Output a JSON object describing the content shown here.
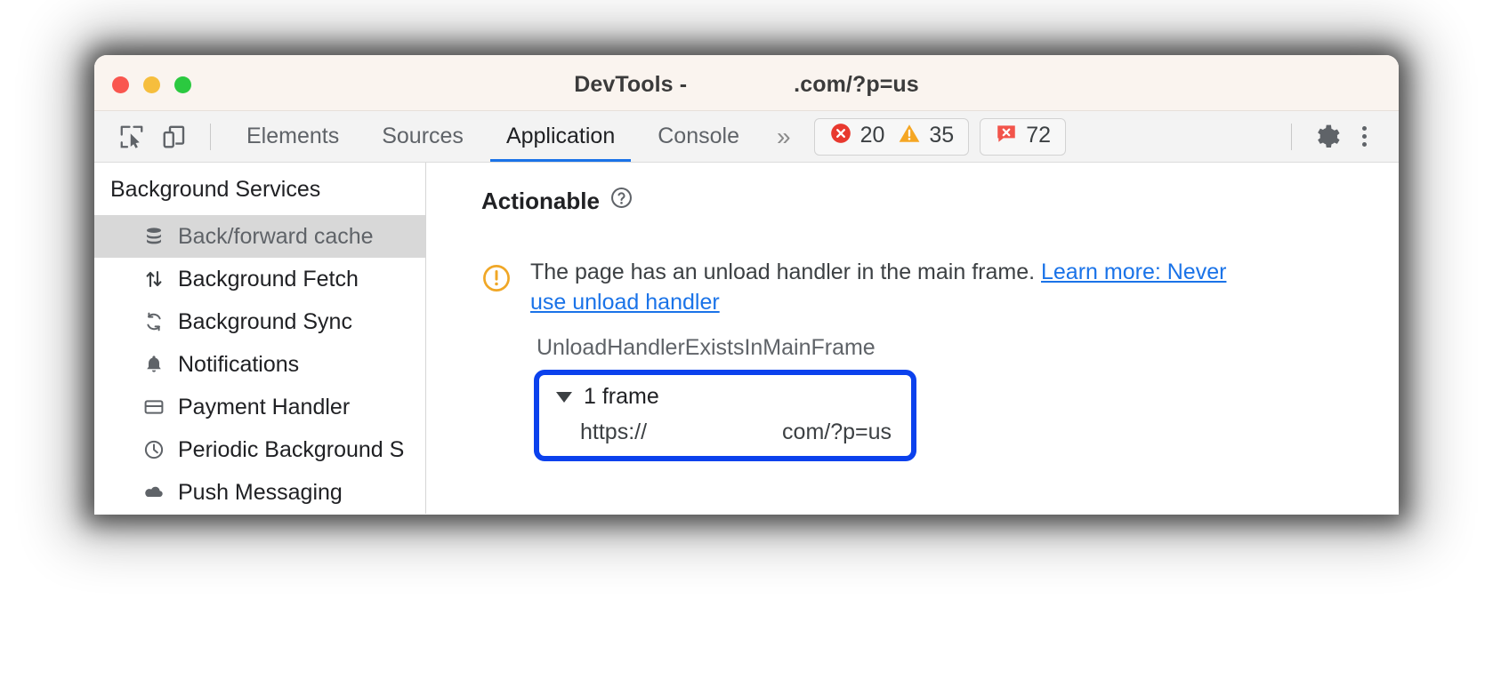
{
  "window": {
    "title_prefix": "DevTools -",
    "title_suffix": ".com/?p=us",
    "traffic_lights": [
      "close",
      "minimize",
      "maximize"
    ]
  },
  "toolbar": {
    "inspect_icon": "inspect-element-icon",
    "device_icon": "device-toolbar-icon",
    "overflow_label": "»",
    "tabs": [
      {
        "label": "Elements",
        "active": false
      },
      {
        "label": "Sources",
        "active": false
      },
      {
        "label": "Application",
        "active": true
      },
      {
        "label": "Console",
        "active": false
      }
    ],
    "counters": [
      {
        "name": "errors",
        "icon": "error-circle-icon",
        "value": "20",
        "color": "#e8392f"
      },
      {
        "name": "warnings",
        "icon": "warning-triangle-icon",
        "value": "35",
        "color": "#f5a623"
      },
      {
        "name": "issues",
        "icon": "issue-bubble-icon",
        "value": "72",
        "color": "#f2544b"
      }
    ],
    "settings_icon": "gear-icon",
    "more_icon": "kebab-menu-icon",
    "active_tab_color": "#1a73e8"
  },
  "sidebar": {
    "section_title": "Background Services",
    "items": [
      {
        "label": "Back/forward cache",
        "icon": "database-icon",
        "selected": true
      },
      {
        "label": "Background Fetch",
        "icon": "up-down-arrows-icon",
        "selected": false
      },
      {
        "label": "Background Sync",
        "icon": "sync-arrows-icon",
        "selected": false
      },
      {
        "label": "Notifications",
        "icon": "bell-icon",
        "selected": false
      },
      {
        "label": "Payment Handler",
        "icon": "credit-card-icon",
        "selected": false
      },
      {
        "label": "Periodic Background S",
        "icon": "clock-icon",
        "selected": false
      },
      {
        "label": "Push Messaging",
        "icon": "cloud-icon",
        "selected": false
      }
    ]
  },
  "main": {
    "heading": "Actionable",
    "help_icon": "help-circle-icon",
    "issue": {
      "icon": "warning-circle-icon",
      "text": "The page has an unload handler in the main frame. ",
      "link_text": "Learn more: Never use unload handler"
    },
    "reason_code": "UnloadHandlerExistsInMainFrame",
    "frame_tree": {
      "toggle_icon": "triangle-down-icon",
      "label": "1 frame",
      "url_prefix": "https://",
      "url_suffix": "com/?p=us",
      "highlight_color": "#0b41ed"
    }
  }
}
